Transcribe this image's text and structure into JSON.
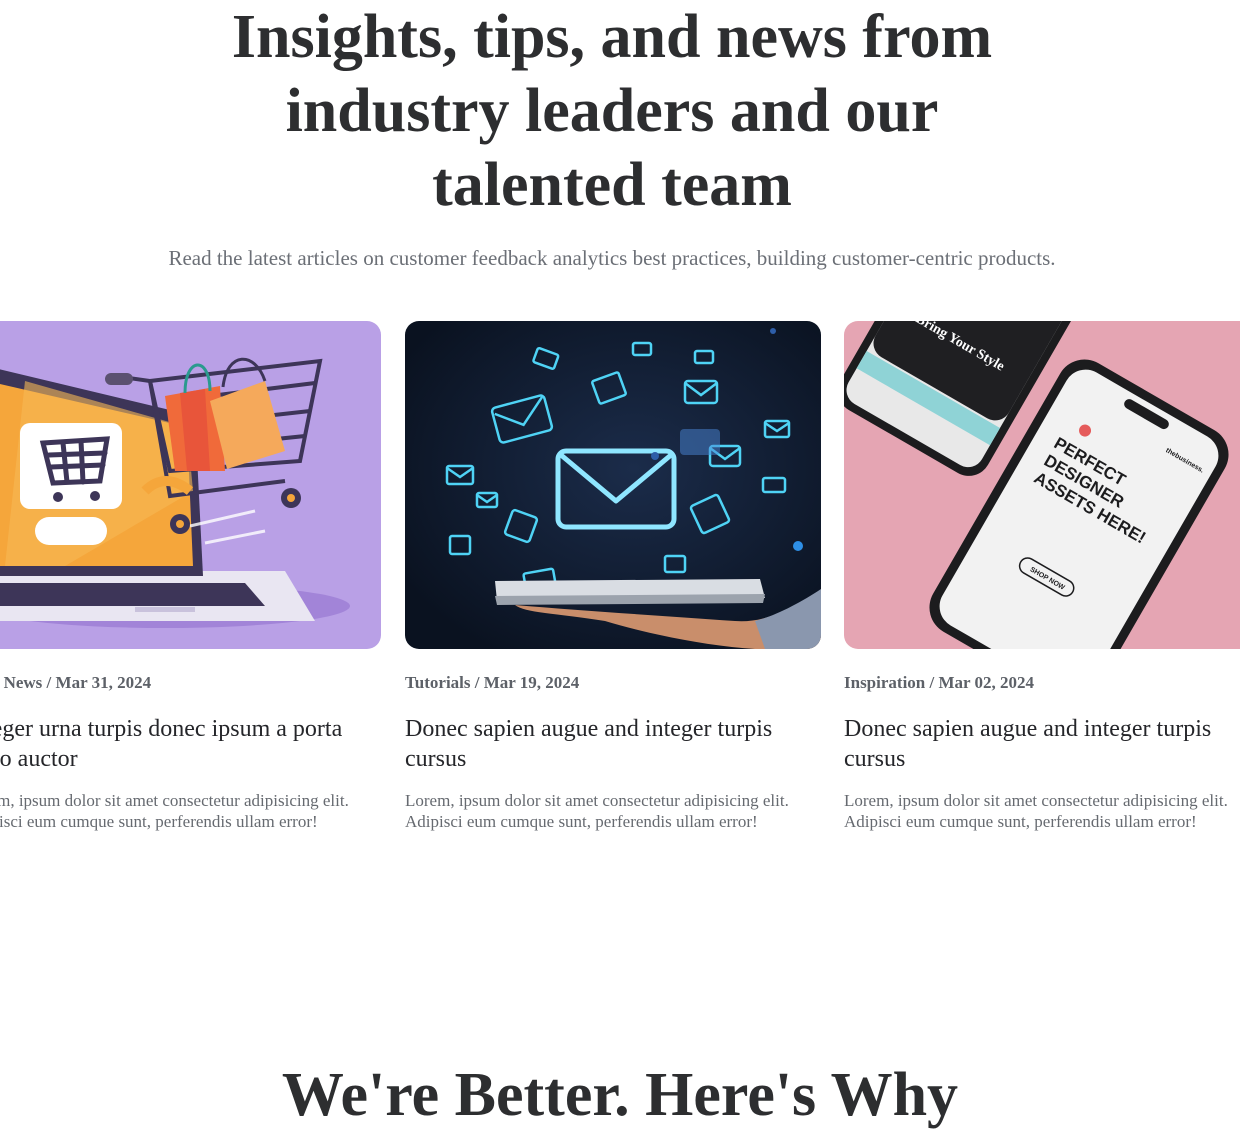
{
  "hero": {
    "title": "Insights, tips, and news from industry leaders and our talented team",
    "subtitle": "Read the latest articles on customer feedback analytics best practices, building customer-centric products."
  },
  "cards": [
    {
      "category": "Tech News",
      "separator": " / ",
      "date": "Mar 31, 2024",
      "title": "Integer urna turpis donec ipsum a porta justo auctor",
      "excerpt": "Lorem, ipsum dolor sit amet consectetur adipisicing elit. Adipisci eum cumque sunt, perferendis ullam error!",
      "image": "shopping-cart-laptop-illustration"
    },
    {
      "category": "Tutorials",
      "separator": " / ",
      "date": "Mar 19, 2024",
      "title": "Donec sapien augue and integer turpis cursus",
      "excerpt": "Lorem, ipsum dolor sit amet consectetur adipisicing elit. Adipisci eum cumque sunt, perferendis ullam error!",
      "image": "email-envelopes-hand-tablet"
    },
    {
      "category": "Inspiration",
      "separator": " / ",
      "date": "Mar 02, 2024",
      "title": "Donec sapien augue and integer turpis cursus",
      "excerpt": "Lorem, ipsum dolor sit amet consectetur adipisicing elit. Adipisci eum cumque sunt, perferendis ullam error!",
      "image": "smartphone-mockups-pink",
      "phone_text": {
        "headline": "PERFECT DESIGNER ASSETS HERE!",
        "brand": "thebusiness.",
        "button": "SHOP NOW",
        "back_title": "Bring Your Style"
      }
    }
  ],
  "next_section": {
    "title": "We're Better. Here's Why"
  },
  "colors": {
    "heading": "#2d2e30",
    "muted": "#6b6f76",
    "card1_bg": "#b9a0e6",
    "card2_bg": "#0f1a2c",
    "card3_bg": "#e5a5b3",
    "glow": "#4fd3f5"
  }
}
